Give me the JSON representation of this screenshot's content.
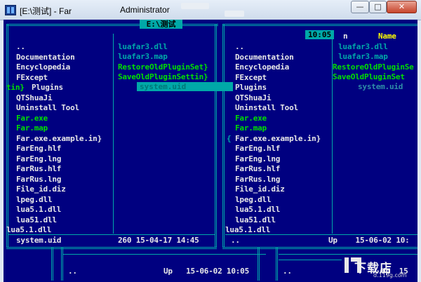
{
  "window": {
    "title": "[E:\\测试] - Far",
    "user": "Administrator",
    "min_label": "—",
    "max_label": "□",
    "close_label": "✕"
  },
  "clock": "10:05",
  "left_panel": {
    "header": " E:\\测试 ",
    "col1": [
      "..",
      "Documentation",
      "Encyclopedia",
      "FExcept",
      "Plugins",
      "QTShuaJi",
      "Uninstall Tool",
      "Far.exe",
      "Far.map",
      "Far.exe.example.in}",
      "FarEng.hlf",
      "FarEng.lng",
      "FarRus.hlf",
      "FarRus.lng",
      "File_id.diz",
      "lpeg.dll",
      "lua5.1.dll",
      "lua51.dll",
      "lua5.1.dll"
    ],
    "col1_prefix_row4": "tin}",
    "col2": [
      "luafar3.dll",
      "luafar3.map",
      "RestoreOldPluginSet}",
      "SaveOldPluginSettin}",
      "system.uid"
    ],
    "status_name": "system.uid",
    "status_info": "260 15-04-17 14:45"
  },
  "right_panel": {
    "col_header": "n",
    "name_header": "Name",
    "col1": [
      "..",
      "Documentation",
      "Encyclopedia",
      "FExcept",
      "Plugins",
      "QTShuaJi",
      "Uninstall Tool",
      "Far.exe",
      "Far.map",
      "Far.exe.example.in}",
      "FarEng.hlf",
      "FarEng.lng",
      "FarRus.hlf",
      "FarRus.lng",
      "File_id.diz",
      "lpeg.dll",
      "lua5.1.dll",
      "lua51.dll",
      "lua5.1.dll"
    ],
    "col1_prefix_row9": "{",
    "col2": [
      "luafar3.dll",
      "luafar3.map",
      "RestoreOldPluginSe",
      "SaveOldPluginSet",
      "system.uid"
    ],
    "status_name": "..",
    "status_info": "Up    15-06-02 10:"
  },
  "bottom_panel": {
    "name": "..",
    "info": "Up   15-06-02 10:05",
    "right_name": "..",
    "right_info": "Up  15"
  },
  "watermark": {
    "text": "下载店",
    "url": "d.119g.com"
  },
  "colors": {
    "console_bg": "#000080",
    "frame": "#00a8a8",
    "exe": "#00e000",
    "header_name": "#ffff00",
    "text": "#e8e8e8"
  }
}
